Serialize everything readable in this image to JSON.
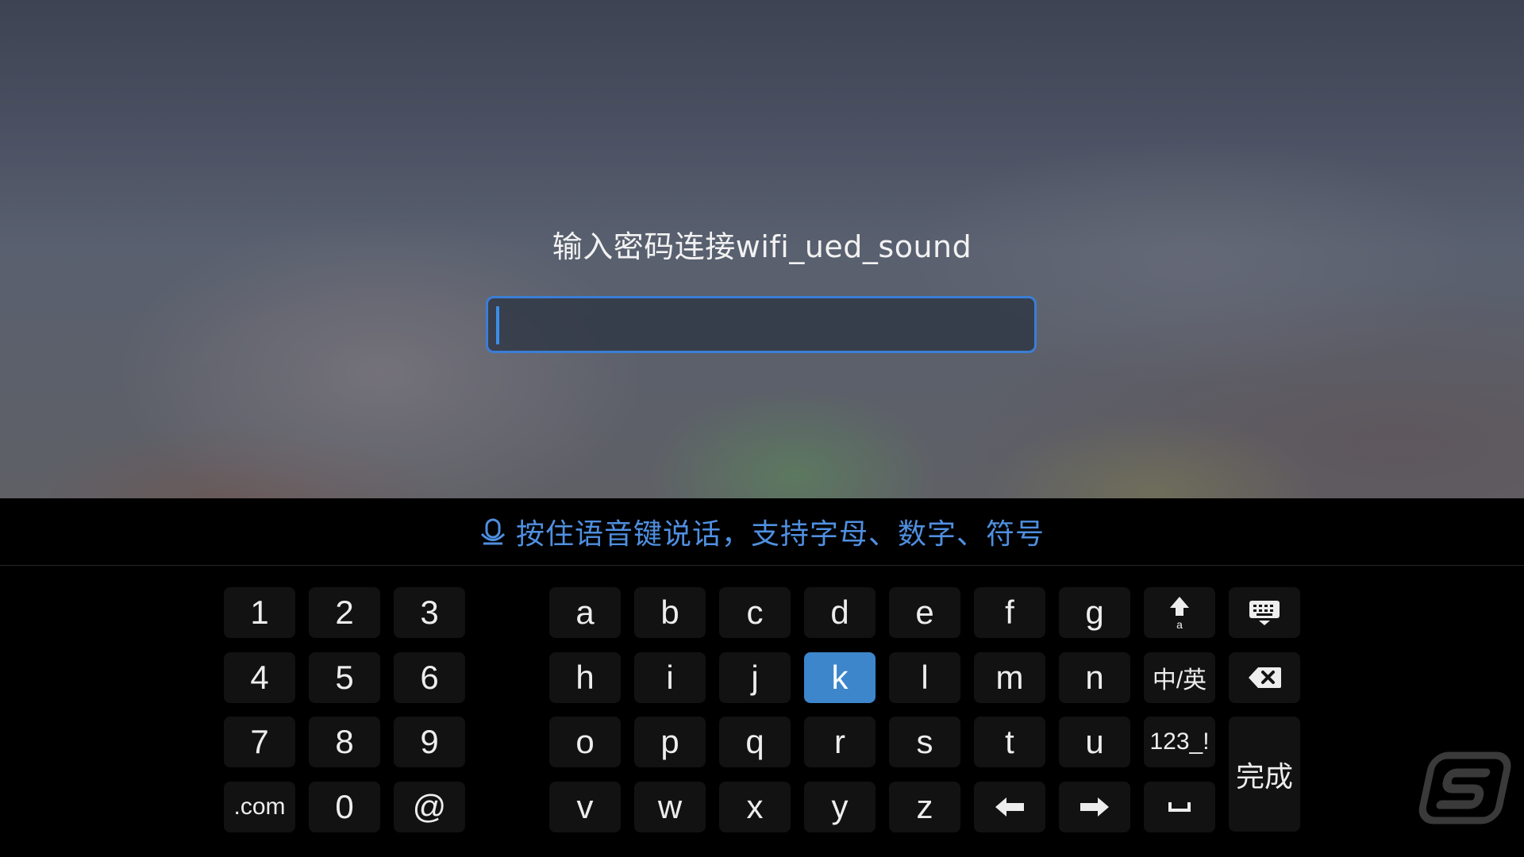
{
  "dialog": {
    "prompt": "输入密码连接wifi_ued_sound",
    "password_value": ""
  },
  "voice_hint": "按住语音键说话，支持字母、数字、符号",
  "keyboard": {
    "numpad": [
      [
        "1",
        "2",
        "3"
      ],
      [
        "4",
        "5",
        "6"
      ],
      [
        "7",
        "8",
        "9"
      ],
      [
        ".com",
        "0",
        "@"
      ]
    ],
    "letters": [
      [
        "a",
        "b",
        "c",
        "d",
        "e",
        "f",
        "g"
      ],
      [
        "h",
        "i",
        "j",
        "k",
        "l",
        "m",
        "n"
      ],
      [
        "o",
        "p",
        "q",
        "r",
        "s",
        "t",
        "u"
      ],
      [
        "v",
        "w",
        "x",
        "y",
        "z"
      ]
    ],
    "focused_key": "k",
    "lang_switch_label": "中/英",
    "symbols_label": "123_!",
    "done_label": "完成",
    "icons": {
      "shift": "shift-arrow-icon",
      "hide_keyboard": "keyboard-hide-icon",
      "backspace": "backspace-icon",
      "left": "arrow-left-icon",
      "right": "arrow-right-icon",
      "space": "space-bar-icon"
    }
  },
  "colors": {
    "accent": "#3b7ed6",
    "focused_key": "#3d86cc",
    "voice_hint": "#4f8fe0",
    "key_bg": "#121212"
  }
}
